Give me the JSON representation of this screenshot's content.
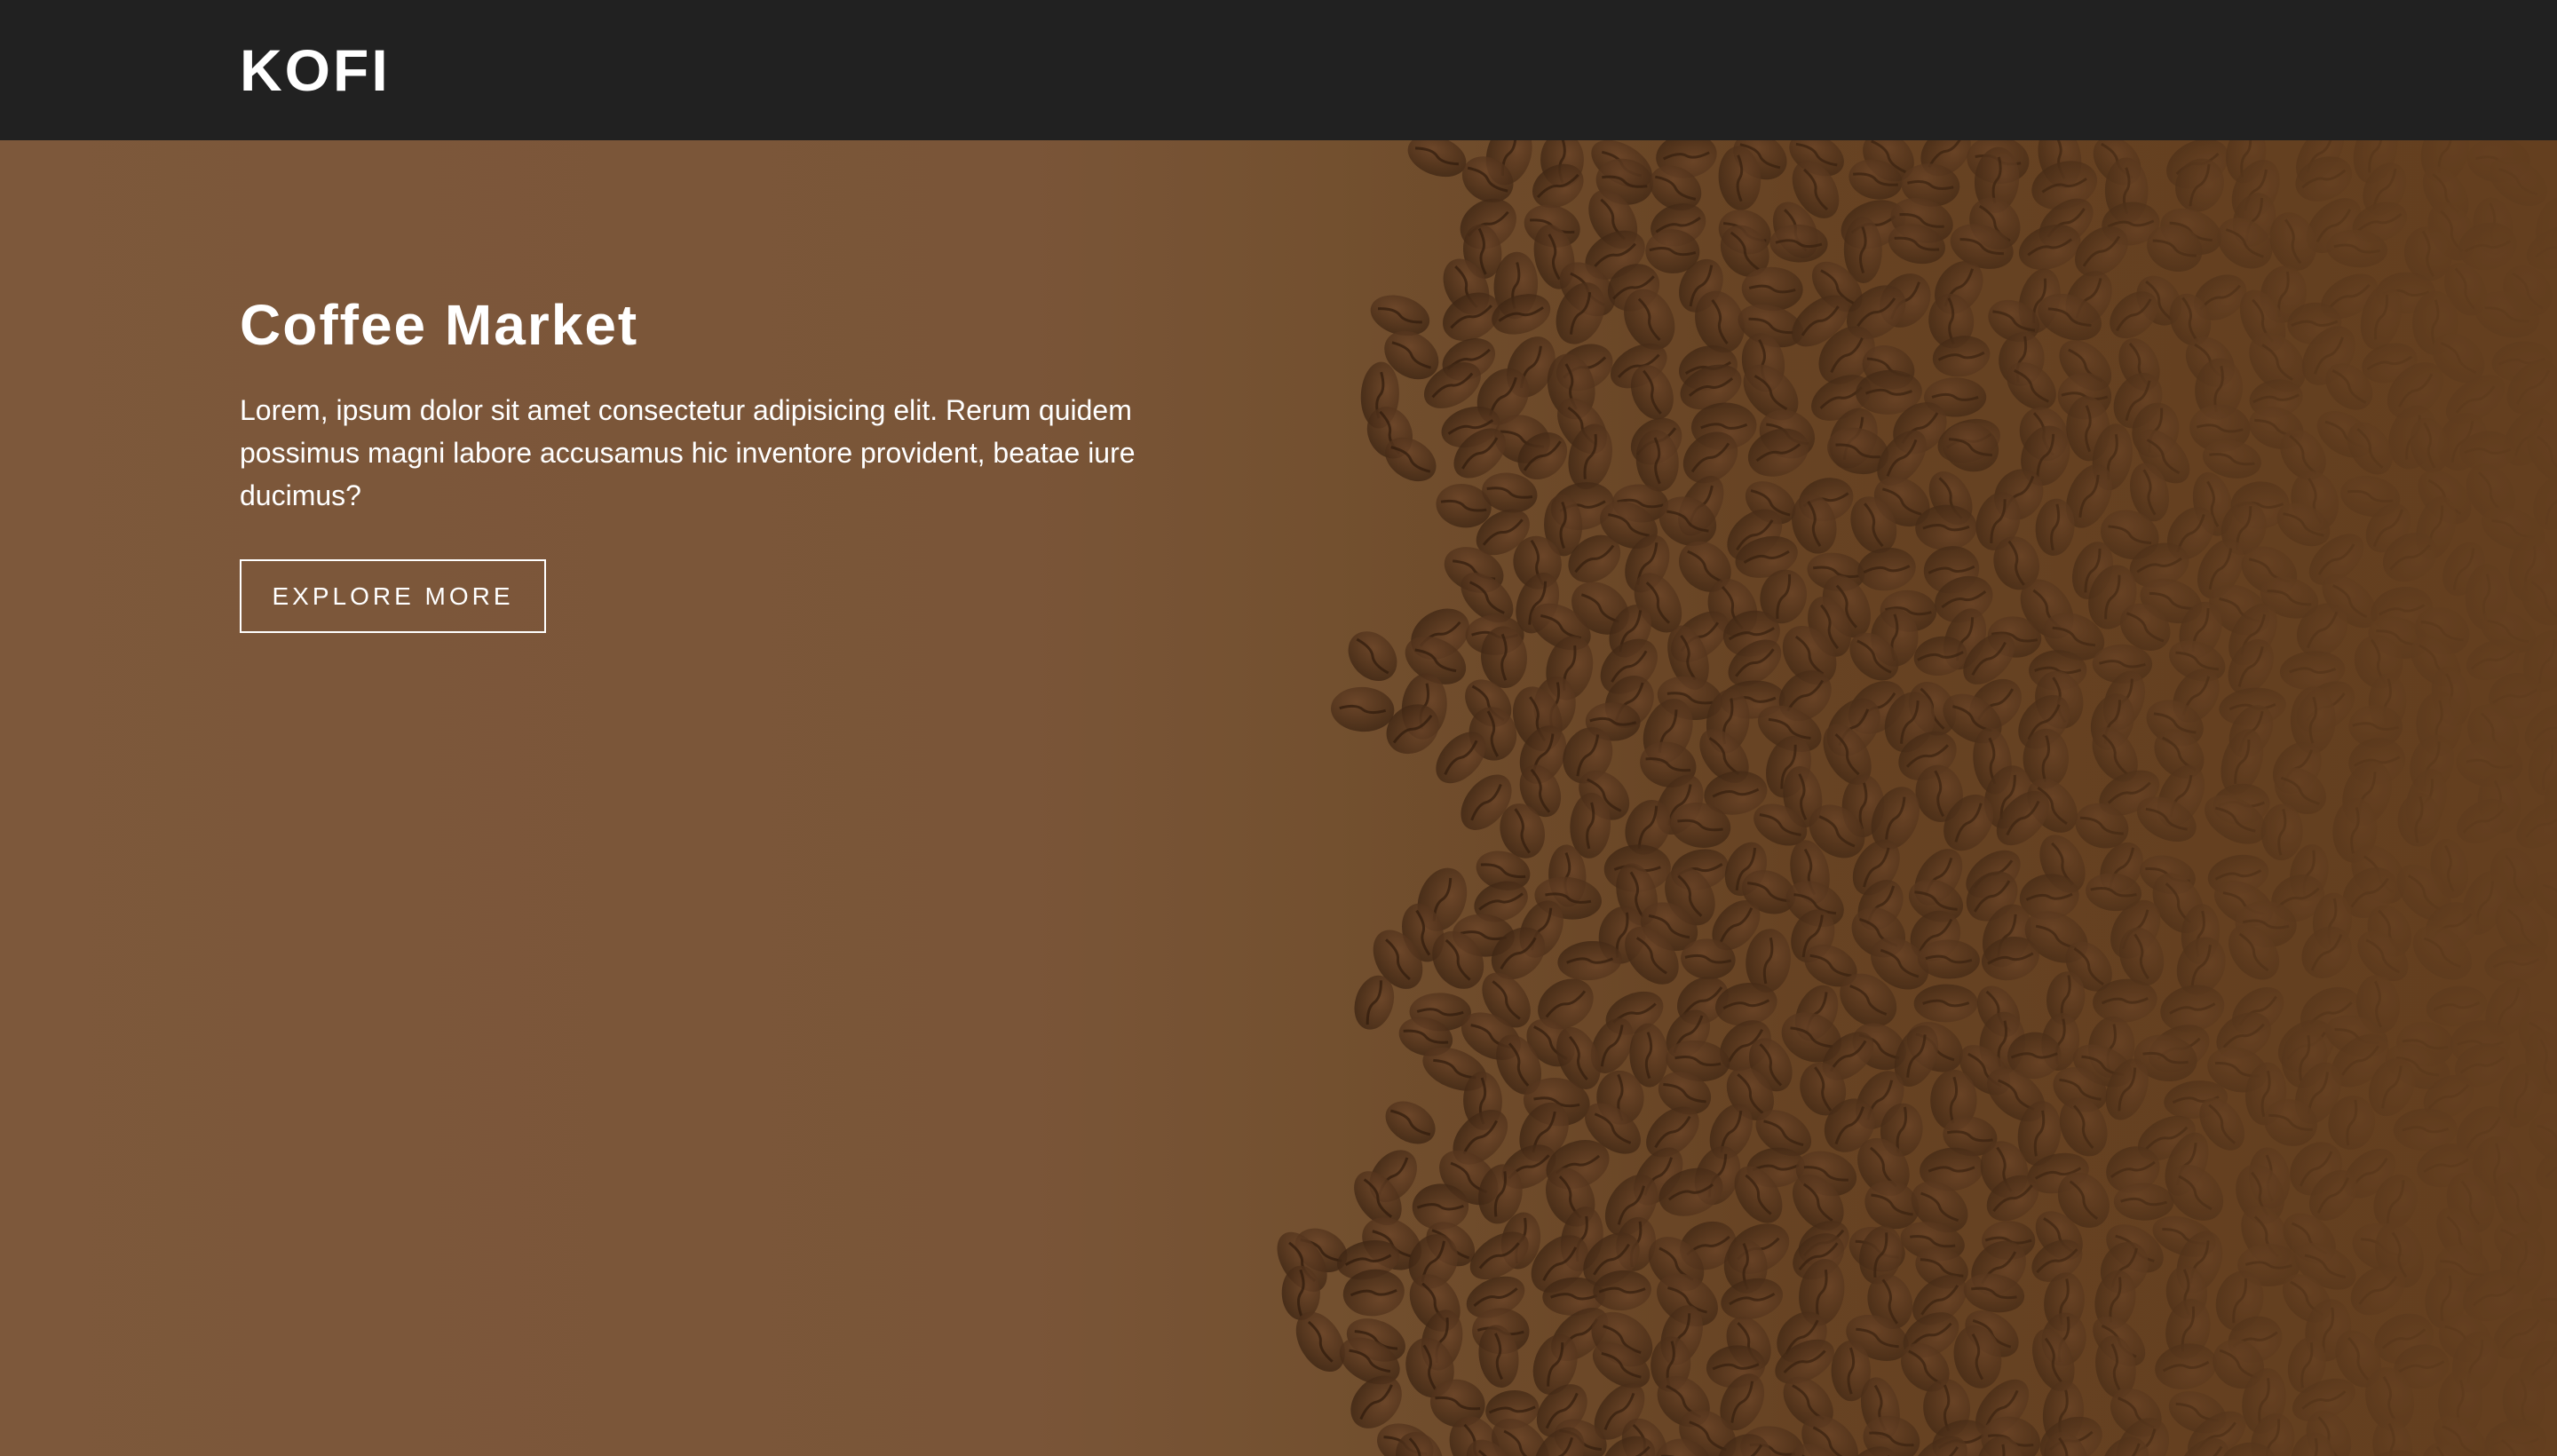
{
  "navbar": {
    "brand": "KOFI"
  },
  "hero": {
    "title": "Coffee Market",
    "description": "Lorem, ipsum dolor sit amet consectetur adipisicing elit. Rerum quidem possimus magni labore accusamus hic inventore provident, beatae iure ducimus?",
    "button_label": "EXPLORE MORE",
    "background_image": "coffee-beans-image"
  },
  "colors": {
    "navbar": "#212121",
    "hero_light": "#7d583b",
    "hero_dark": "#643f1f",
    "bean": "#4a2e18",
    "text": "#ffffff"
  }
}
